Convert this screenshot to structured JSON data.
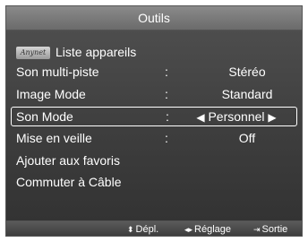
{
  "window": {
    "title": "Outils"
  },
  "menu": {
    "items": [
      {
        "label": "Liste appareils",
        "icon": "anynet-logo-icon",
        "value": ""
      },
      {
        "label": "Son multi-piste",
        "value": "Stéréo"
      },
      {
        "label": "Image Mode",
        "value": "Standard"
      },
      {
        "label": "Son Mode",
        "value": "Personnel",
        "selected": true
      },
      {
        "label": "Mise en veille",
        "value": "Off"
      },
      {
        "label": "Ajouter aux favoris",
        "value": ""
      },
      {
        "label": "Commuter à Câble",
        "value": ""
      }
    ],
    "colon": ":"
  },
  "footer": {
    "move_label": "Dépl.",
    "adjust_label": "Réglage",
    "exit_label": "Sortie"
  }
}
